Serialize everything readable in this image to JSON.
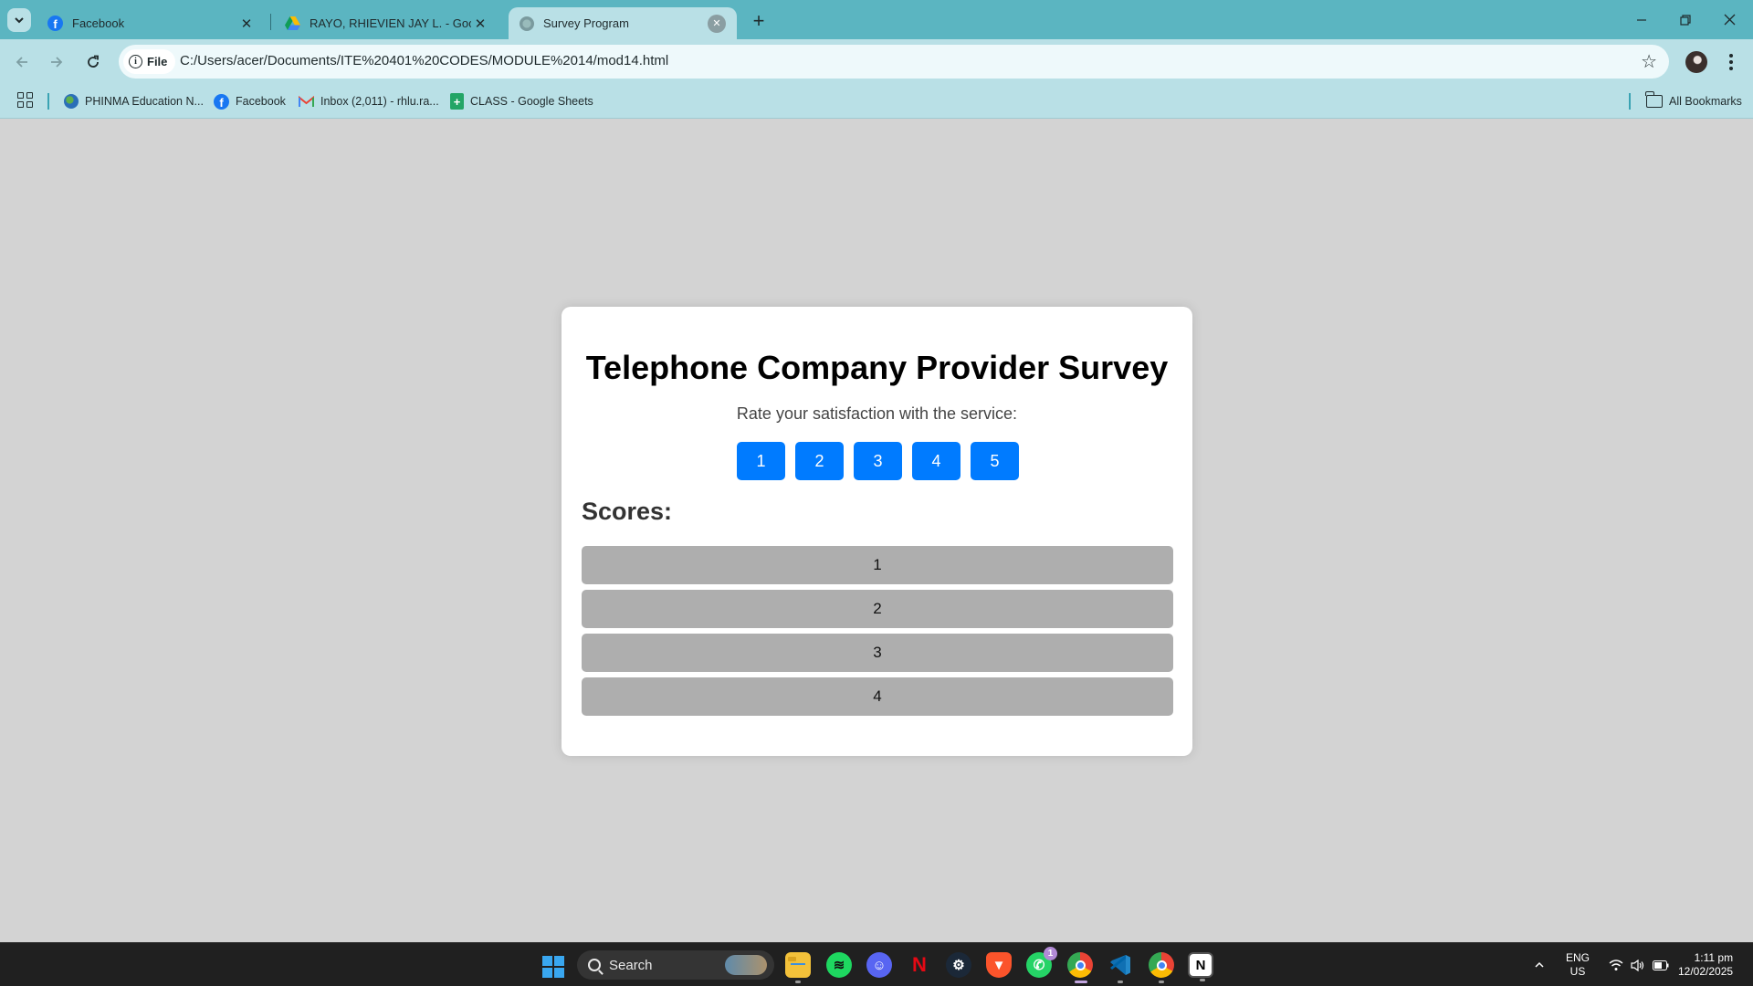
{
  "browser": {
    "tabs": [
      {
        "title": "Facebook",
        "icon": "facebook-icon",
        "active": false
      },
      {
        "title": "RAYO, RHIEVIEN JAY L. - Google D",
        "icon": "google-drive-icon",
        "active": false
      },
      {
        "title": "Survey Program",
        "icon": "globe-icon",
        "active": true
      }
    ],
    "address": {
      "chip_label": "File",
      "url": "C:/Users/acer/Documents/ITE%20401%20CODES/MODULE%2014/mod14.html"
    },
    "bookmarks": [
      {
        "label": "PHINMA Education N...",
        "icon": "globe-icon"
      },
      {
        "label": "Facebook",
        "icon": "facebook-icon"
      },
      {
        "label": "Inbox (2,011) - rhlu.ra...",
        "icon": "gmail-icon"
      },
      {
        "label": "CLASS - Google Sheets",
        "icon": "sheets-icon"
      }
    ],
    "all_bookmarks_label": "All Bookmarks"
  },
  "survey": {
    "title": "Telephone Company Provider Survey",
    "prompt": "Rate your satisfaction with the service:",
    "rating_buttons": [
      "1",
      "2",
      "3",
      "4",
      "5"
    ],
    "scores_heading": "Scores:",
    "scores": [
      "1",
      "2",
      "3",
      "4"
    ]
  },
  "taskbar": {
    "search_placeholder": "Search",
    "whatsapp_badge": "1",
    "language": "ENG",
    "region": "US",
    "time": "1:11 pm",
    "date": "12/02/2025"
  },
  "colors": {
    "page_background": "#d3d3d3",
    "rating_button": "#007bff",
    "score_item": "#aeaeae",
    "browser_frame": "#5bb5c1",
    "toolbar": "#b9e0e6"
  }
}
